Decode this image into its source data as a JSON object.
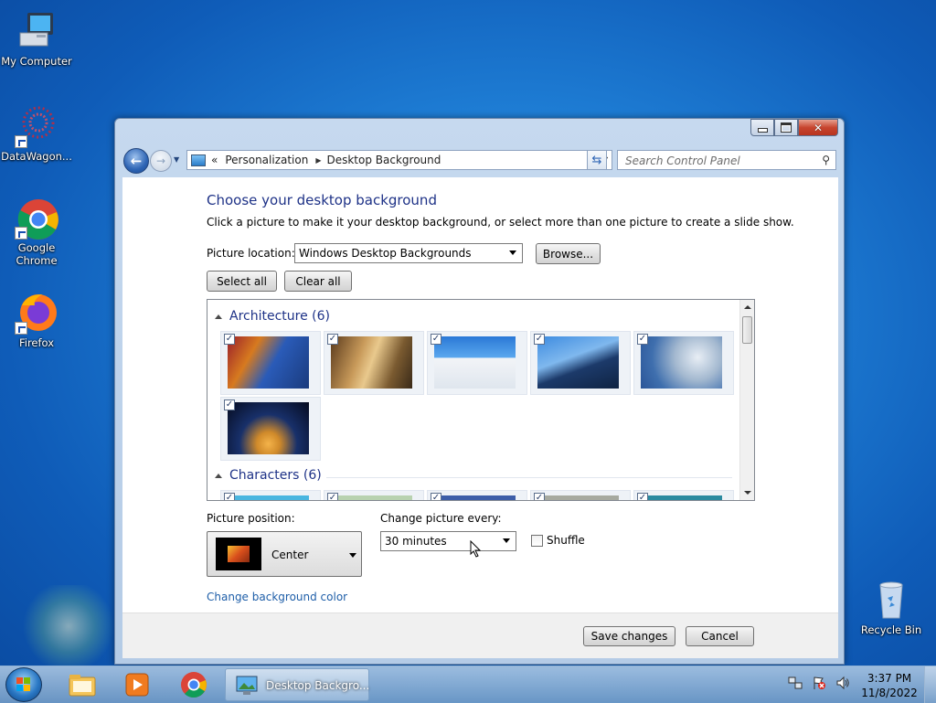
{
  "desktop": {
    "icons": [
      {
        "label": "My Computer"
      },
      {
        "label": "DataWagon..."
      },
      {
        "label": "Google Chrome"
      },
      {
        "label": "Firefox"
      },
      {
        "label": "Recycle Bin"
      }
    ]
  },
  "window": {
    "breadcrumb": {
      "chevron": "«",
      "items": [
        "Personalization",
        "Desktop Background"
      ]
    },
    "search_placeholder": "Search Control Panel",
    "title": "Choose your desktop background",
    "description": "Click a picture to make it your desktop background, or select more than one picture to create a slide show.",
    "picture_location_label": "Picture location:",
    "picture_location_value": "Windows Desktop Backgrounds",
    "browse_label": "Browse...",
    "select_all_label": "Select all",
    "clear_all_label": "Clear all",
    "groups": [
      {
        "label": "Architecture (6)",
        "count": 6,
        "selected": true
      },
      {
        "label": "Characters (6)",
        "count": 6,
        "selected": true
      }
    ],
    "picture_position_label": "Picture position:",
    "picture_position_value": "Center",
    "change_every_label": "Change picture every:",
    "change_every_value": "30 minutes",
    "shuffle_label": "Shuffle",
    "shuffle_checked": false,
    "bg_color_link": "Change background color",
    "save_label": "Save changes",
    "cancel_label": "Cancel"
  },
  "taskbar": {
    "task_label": "Desktop Backgro...",
    "time": "3:37 PM",
    "date": "11/8/2022"
  }
}
